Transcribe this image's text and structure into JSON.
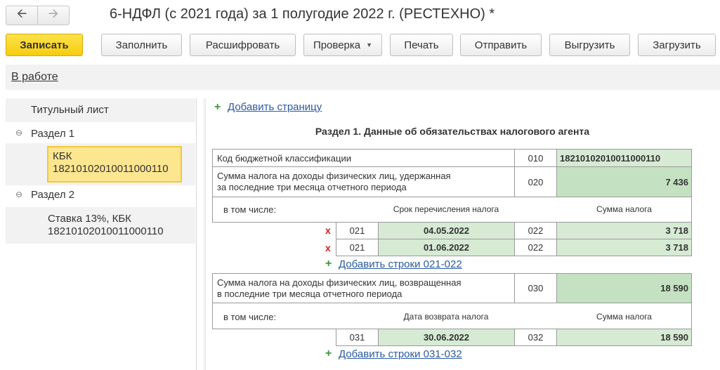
{
  "window": {
    "title": "6-НДФЛ (с 2021 года) за 1 полугодие 2022 г. (РЕСТЕХНО) *",
    "back_icon": "arrow-left-icon",
    "forward_icon": "arrow-right-icon"
  },
  "toolbar": {
    "save": "Записать",
    "fill": "Заполнить",
    "decode": "Расшифровать",
    "check": "Проверка",
    "print": "Печать",
    "send": "Отправить",
    "upload": "Выгрузить",
    "download": "Загрузить"
  },
  "status": {
    "label": "В работе"
  },
  "tree": {
    "title_page": "Титульный лист",
    "section1": "Раздел 1",
    "kbk_label": "КБК",
    "kbk_value": "18210102010011000110",
    "section2": "Раздел 2",
    "rate_label": "Ставка 13%, КБК",
    "rate_kbk": "18210102010011000110"
  },
  "form": {
    "add_page": "Добавить страницу",
    "section_title": "Раздел 1. Данные об обязательствах налогового агента",
    "kbk_row": {
      "label": "Код бюджетной классификации",
      "code": "010",
      "value": "18210102010011000110"
    },
    "withheld_row": {
      "label_line1": "Сумма налога на доходы физических лиц, удержанная",
      "label_line2": "за последние три месяца отчетного периода",
      "code": "020",
      "value": "7 436"
    },
    "incl_header1": {
      "label": "в том числе:",
      "col1": "Срок перечисления налога",
      "col2": "Сумма налога"
    },
    "rows_021": [
      {
        "code1": "021",
        "date": "04.05.2022",
        "code2": "022",
        "sum": "3 718"
      },
      {
        "code1": "021",
        "date": "01.06.2022",
        "code2": "022",
        "sum": "3 718"
      }
    ],
    "add_021": "Добавить строки 021-022",
    "returned_row": {
      "label_line1": "Сумма налога на доходы физических лиц, возвращенная",
      "label_line2": "в последние три месяца отчетного периода",
      "code": "030",
      "value": "18 590"
    },
    "incl_header2": {
      "label": "в том числе:",
      "col1": "Дата возврата налога",
      "col2": "Сумма налога"
    },
    "rows_031": [
      {
        "code1": "031",
        "date": "30.06.2022",
        "code2": "032",
        "sum": "18 590"
      }
    ],
    "add_031": "Добавить строки 031-032",
    "delete_icon": "x-icon",
    "add_icon": "plus-icon"
  }
}
